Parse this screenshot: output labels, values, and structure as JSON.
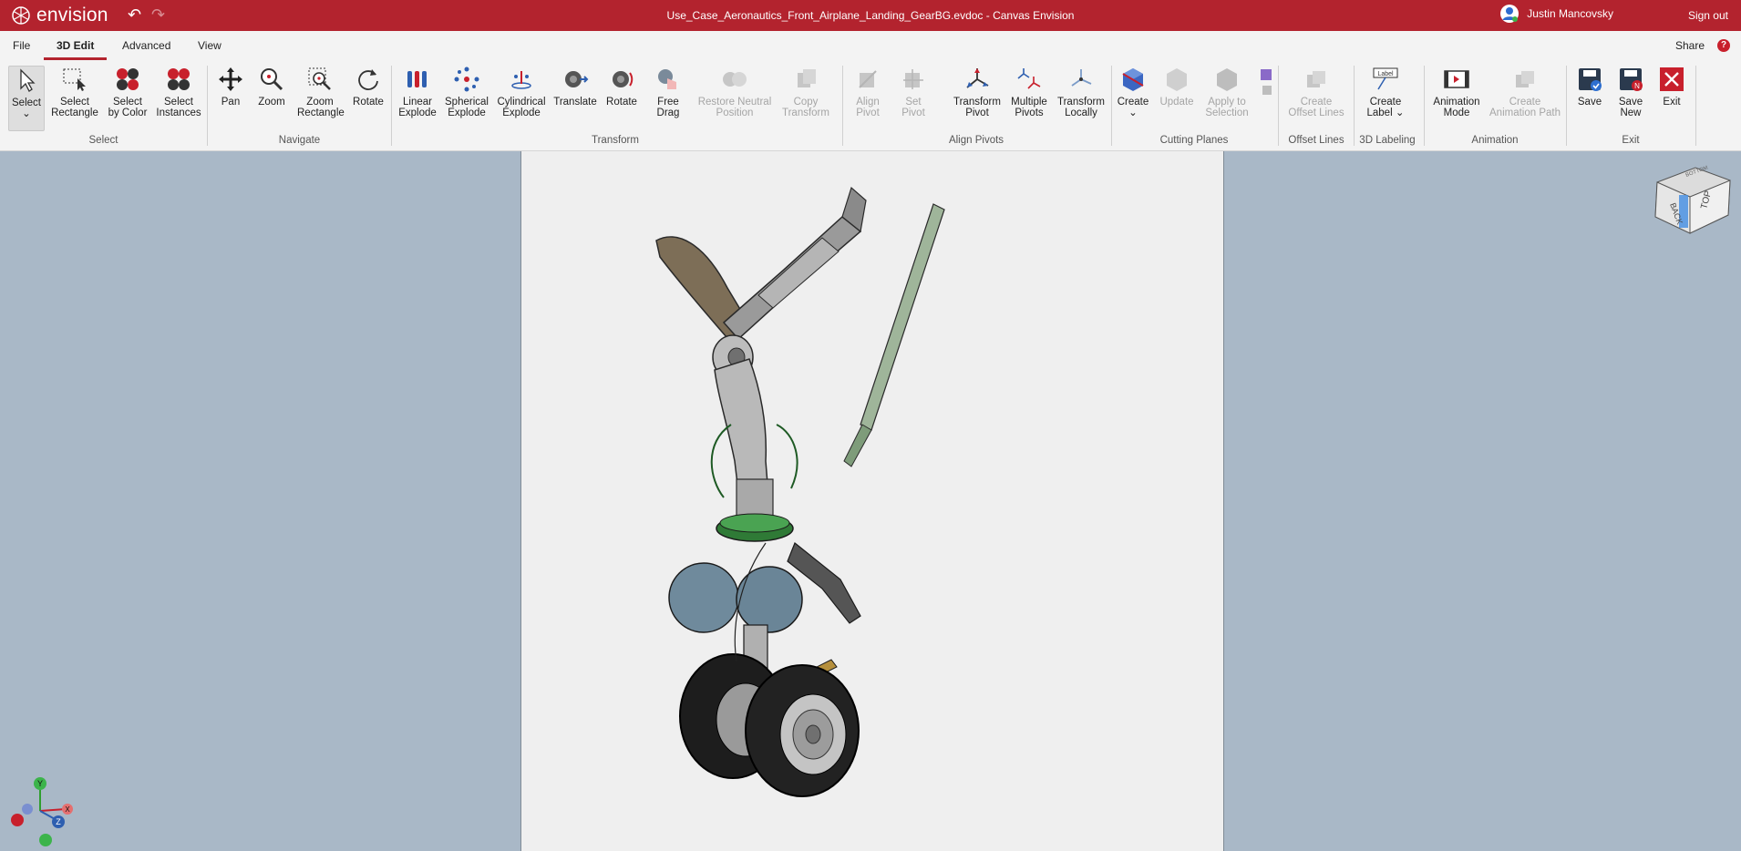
{
  "app": {
    "name": "envision",
    "doc_title": "Use_Case_Aeronautics_Front_Airplane_Landing_GearBG.evdoc - Canvas Envision"
  },
  "user": {
    "name": "Justin Mancovsky",
    "sign_out": "Sign out"
  },
  "tabs": [
    {
      "label": "File"
    },
    {
      "label": "3D Edit"
    },
    {
      "label": "Advanced"
    },
    {
      "label": "View"
    }
  ],
  "share": "Share",
  "ribbon": {
    "select": {
      "label": "Select",
      "group": "Select"
    },
    "select_rect": {
      "l1": "Select",
      "l2": "Rectangle"
    },
    "select_color": {
      "l1": "Select",
      "l2": "by Color"
    },
    "select_inst": {
      "l1": "Select",
      "l2": "Instances"
    },
    "pan": "Pan",
    "zoom": "Zoom",
    "zoom_rect": {
      "l1": "Zoom",
      "l2": "Rectangle"
    },
    "rotate_nav": "Rotate",
    "navigate_group": "Navigate",
    "linear": {
      "l1": "Linear",
      "l2": "Explode"
    },
    "spherical": {
      "l1": "Spherical",
      "l2": "Explode"
    },
    "cylindrical": {
      "l1": "Cylindrical",
      "l2": "Explode"
    },
    "translate": "Translate",
    "rotate_tr": "Rotate",
    "free_drag": {
      "l1": "Free",
      "l2": "Drag"
    },
    "restore": {
      "l1": "Restore Neutral",
      "l2": "Position"
    },
    "copy_tr": {
      "l1": "Copy",
      "l2": "Transform"
    },
    "transform_group": "Transform",
    "align_pivot": {
      "l1": "Align",
      "l2": "Pivot"
    },
    "set_pivot": {
      "l1": "Set",
      "l2": "Pivot"
    },
    "transform_pivot": {
      "l1": "Transform",
      "l2": "Pivot"
    },
    "multiple_pivots": {
      "l1": "Multiple",
      "l2": "Pivots"
    },
    "transform_locally": {
      "l1": "Transform",
      "l2": "Locally"
    },
    "align_pivots_group": "Align Pivots",
    "create": "Create",
    "update": "Update",
    "apply_sel": {
      "l1": "Apply to",
      "l2": "Selection"
    },
    "cutting_group": "Cutting Planes",
    "offset_lines": {
      "l1": "Create",
      "l2": "Offset Lines"
    },
    "offset_group": "Offset Lines",
    "create_label": {
      "l1": "Create",
      "l2": "Label",
      "icon_text": "Label"
    },
    "labeling_group": "3D Labeling",
    "anim_mode": {
      "l1": "Animation",
      "l2": "Mode"
    },
    "anim_path": {
      "l1": "Create",
      "l2": "Animation Path"
    },
    "animation_group": "Animation",
    "save": "Save",
    "save_new": {
      "l1": "Save",
      "l2": "New"
    },
    "exit": "Exit",
    "exit_group": "Exit"
  },
  "viewcube": {
    "front": "BACK",
    "top": "TOP",
    "side": "BOTTOM"
  },
  "axis": {
    "y": "Y",
    "x": "X",
    "z": "Z"
  },
  "colors": {
    "brand": "#b3232e",
    "ribbon_bg": "#f3f3f3",
    "viewport_bg": "#a9b8c7",
    "paper": "#efefef"
  }
}
